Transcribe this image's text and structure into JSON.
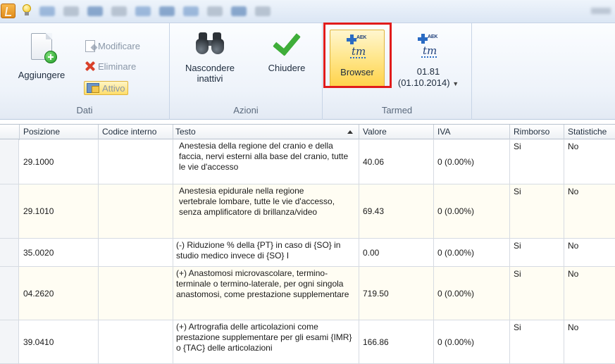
{
  "ribbon": {
    "dati": {
      "label": "Dati",
      "aggiungere": "Aggiungere",
      "modificare": "Modificare",
      "eliminare": "Eliminare",
      "attivo": "Attivo"
    },
    "azioni": {
      "label": "Azioni",
      "nascondere_line1": "Nascondere",
      "nascondere_line2": "inattivi",
      "chiudere": "Chiudere"
    },
    "tarmed": {
      "label": "Tarmed",
      "browser": "Browser",
      "version_line1": "01.81",
      "version_line2": "(01.10.2014)",
      "icon_text_aek": "AEK",
      "icon_text_tm": "tm"
    }
  },
  "grid": {
    "columns": [
      "Posizione",
      "Codice interno",
      "Testo",
      "Valore",
      "IVA",
      "Rimborso",
      "Statistiche"
    ],
    "rows": [
      {
        "posizione": "29.1000",
        "codice": "",
        "testo": "Anestesia della regione del cranio e della faccia, nervi esterni alla base del cranio, tutte le vie d'accesso",
        "valore": "40.06",
        "iva": "0 (0.00%)",
        "rimborso": "Si",
        "statistiche": "No"
      },
      {
        "posizione": "29.1010",
        "codice": "",
        "testo": "Anestesia epidurale nella regione vertebrale lombare, tutte le vie d'accesso, senza amplificatore di brillanza/video",
        "valore": "69.43",
        "iva": "0 (0.00%)",
        "rimborso": "Si",
        "statistiche": "No"
      },
      {
        "posizione": "35.0020",
        "codice": "",
        "testo": "(-) Riduzione % della {PT} in caso di {SO} in studio medico invece di {SO} I",
        "valore": "0.00",
        "iva": "0 (0.00%)",
        "rimborso": "Si",
        "statistiche": "No"
      },
      {
        "posizione": "04.2620",
        "codice": "",
        "testo": "(+) Anastomosi microvascolare, termino-terminale o termino-laterale, per ogni singola anastomosi, come prestazione supplementare",
        "valore": "719.50",
        "iva": "0 (0.00%)",
        "rimborso": "Si",
        "statistiche": "No"
      },
      {
        "posizione": "39.0410",
        "codice": "",
        "testo": "(+) Artrografia delle articolazioni come prestazione supplementare per gli esami {IMR} o {TAC} delle articolazioni",
        "valore": "166.86",
        "iva": "0 (0.00%)",
        "rimborso": "Si",
        "statistiche": "No"
      }
    ]
  }
}
